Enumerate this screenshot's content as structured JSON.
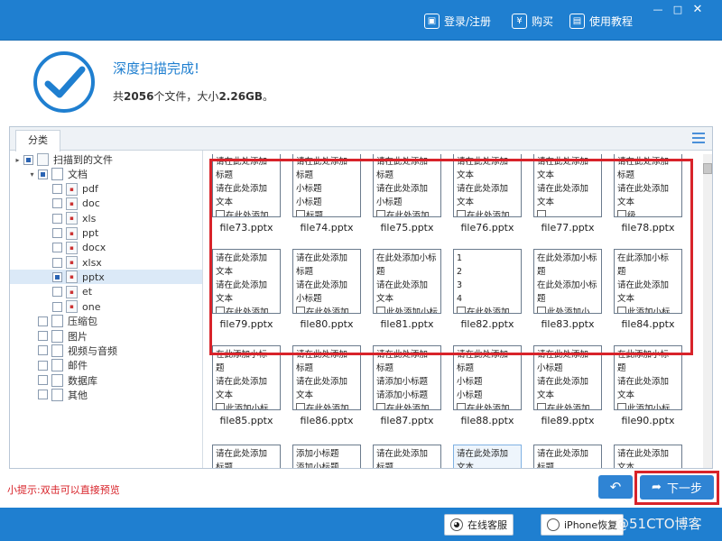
{
  "topbar": {
    "login_label": "登录/注册",
    "buy_label": "购买",
    "tutorial_label": "使用教程",
    "icons": {
      "login": "user-icon",
      "buy": "yen-icon",
      "tutorial": "book-icon"
    }
  },
  "header": {
    "title": "深度扫描完成!",
    "summary_prefix": "共",
    "file_count": "2056",
    "summary_mid": "个文件，大小",
    "total_size": "2.26GB",
    "summary_suffix": "。"
  },
  "tabs": {
    "category": "分类"
  },
  "tree": {
    "root": "扫描到的文件",
    "documents": "文档",
    "doc_types": [
      "pdf",
      "doc",
      "xls",
      "ppt",
      "docx",
      "xlsx",
      "pptx",
      "et",
      "one"
    ],
    "selected": "pptx",
    "groups": [
      "压缩包",
      "图片",
      "视频与音频",
      "邮件",
      "数据库",
      "其他"
    ]
  },
  "files": [
    {
      "name": "file73.pptx",
      "lines": [
        "请在此处添加",
        "标题",
        "请在此处添加",
        "文本",
        "在此处添加"
      ]
    },
    {
      "name": "file74.pptx",
      "lines": [
        "请在此处添加",
        "标题",
        "小标题",
        "小标题",
        "标题"
      ]
    },
    {
      "name": "file75.pptx",
      "lines": [
        "请在此处添加",
        "标题",
        "请在此处添加",
        "小标题",
        "在此处添加"
      ]
    },
    {
      "name": "file76.pptx",
      "lines": [
        "请在此处添加",
        "文本",
        "请在此处添加",
        "文本",
        "在此处添加"
      ]
    },
    {
      "name": "file77.pptx",
      "lines": [
        "请在此处添加",
        "文本",
        "请在此处添加",
        "文本",
        ""
      ]
    },
    {
      "name": "file78.pptx",
      "lines": [
        "请在此处添加",
        "标题",
        "请在此处添加",
        "文本",
        "级"
      ]
    },
    {
      "name": "file79.pptx",
      "lines": [
        "请在此处添加",
        "文本",
        "请在此处添加",
        "文本",
        "在此处添加"
      ]
    },
    {
      "name": "file80.pptx",
      "lines": [
        "请在此处添加",
        "标题",
        "请在此处添加",
        "小标题",
        "在此处添加"
      ]
    },
    {
      "name": "file81.pptx",
      "lines": [
        "在此处添加小标",
        "题",
        "请在此处添加",
        "文本",
        "此处添加小标"
      ]
    },
    {
      "name": "file82.pptx",
      "lines": [
        "1",
        "2",
        "3",
        "4",
        "在此处添加"
      ]
    },
    {
      "name": "file83.pptx",
      "lines": [
        "在此处添加小标",
        "题",
        "在此处添加小标",
        "题",
        "此处添加小"
      ]
    },
    {
      "name": "file84.pptx",
      "lines": [
        "在此添加小标",
        "题",
        "请在此处添加",
        "文本",
        "此添加小标"
      ]
    },
    {
      "name": "file85.pptx",
      "lines": [
        "在此添加小标",
        "题",
        "请在此处添加",
        "文本",
        "此添加小标"
      ]
    },
    {
      "name": "file86.pptx",
      "lines": [
        "请在此处添加",
        "标题",
        "请在此处添加",
        "文本",
        "在此处添加"
      ]
    },
    {
      "name": "file87.pptx",
      "lines": [
        "请在此处添加",
        "标题",
        "请添加小标题",
        "请添加小标题",
        "在此处添加"
      ]
    },
    {
      "name": "file88.pptx",
      "lines": [
        "请在此处添加",
        "标题",
        "小标题",
        "小标题",
        "在此处添加"
      ]
    },
    {
      "name": "file89.pptx",
      "lines": [
        "请在此处添加",
        "小标题",
        "请在此处添加",
        "文本",
        "在此处添加"
      ]
    },
    {
      "name": "file90.pptx",
      "lines": [
        "在此添加小标",
        "题",
        "请在此处添加",
        "文本",
        "此添加小标"
      ]
    },
    {
      "name": "",
      "lines": [
        "请在此处添加",
        "标题"
      ]
    },
    {
      "name": "",
      "lines": [
        "添加小标题",
        "添加小标题"
      ]
    },
    {
      "name": "",
      "lines": [
        "请在此处添加",
        "标题"
      ]
    },
    {
      "name": "",
      "lines": [
        "请在此处添加",
        "文本"
      ]
    },
    {
      "name": "",
      "lines": [
        "请在此处添加",
        "标题"
      ]
    },
    {
      "name": "",
      "lines": [
        "请在此处添加",
        "文本"
      ]
    }
  ],
  "tip": "小提示:双击可以直接预览",
  "buttons": {
    "back": "↶",
    "next": "下一步"
  },
  "bottombar": {
    "service_label": "在线客服",
    "iphone_label": "iPhone恢复",
    "watermark": "@51CTO博客"
  },
  "colors": {
    "primary": "#1f7fd0",
    "highlight": "#d8232a"
  }
}
